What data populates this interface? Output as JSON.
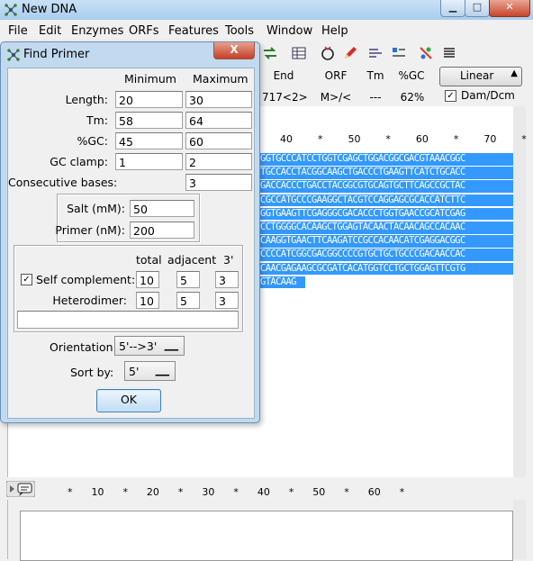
{
  "window": {
    "title": "New DNA",
    "controls": [
      "minimize",
      "maximize",
      "close"
    ]
  },
  "menu": [
    "File",
    "Edit",
    "Enzymes",
    "ORFs",
    "Features",
    "Tools",
    "Window",
    "Help"
  ],
  "info": {
    "headers": {
      "end": "End",
      "orf": "ORF",
      "tm": "Tm",
      "gc": "%GC"
    },
    "values": {
      "end": "717<2>",
      "orf": "M>/<",
      "tm": "---",
      "gc": "62%"
    },
    "topology": "Linear",
    "dam_dcm_label": "Dam/Dcm",
    "dam_dcm_checked": true
  },
  "ruler_top": "40        *        50        *        60        *        70        *",
  "ruler_bottom": "*      10      *      20      *      30      *      40      *      50      *      60      *",
  "sequence_lines": [
    "GGTGCCCATCCTGGTCGAGCTGGACGGCGACGTAAACGGC",
    "TGCCACCTACGGCAAGCTGACCCTGAAGTTCATCTGCACC",
    "GACCACCCTGACCTACGGCGTGCAGTGCTTCAGCCGCTAC",
    "CGCCATGCCCGAAGGCTACGTCCAGGAGCGCACCATCTTC",
    "GGTGAAGTTCGAGGGCGACACCCTGGTGAACCGCATCGAG",
    "CCTGGGGCACAAGCTGGAGTACAACTACAACAGCCACAAC",
    "CAAGGTGAACTTCAAGATCCGCCACAACATCGAGGACGGC",
    "CCCCATCGGCGACGGCCCCGTGCTGCTGCCCGACAACCAC",
    "CAACGAGAAGCGCGATCACATGGTCCTGCTGGAGTTCGTG",
    "GTACAAG"
  ],
  "dialog": {
    "title": "Find Primer",
    "close_label": "X",
    "min_header": "Minimum",
    "max_header": "Maximum",
    "rows": [
      {
        "label": "Length:",
        "min": "20",
        "max": "30"
      },
      {
        "label": "Tm:",
        "min": "58",
        "max": "64"
      },
      {
        "label": "%GC:",
        "min": "45",
        "max": "60"
      },
      {
        "label": "GC clamp:",
        "min": "1",
        "max": "2"
      }
    ],
    "consecutive_label": "Consecutive bases:",
    "consecutive_value": "3",
    "salt_label": "Salt (mM):",
    "salt_value": "50",
    "primer_label": "Primer (nM):",
    "primer_value": "200",
    "dimer_headers": {
      "total": "total",
      "adjacent": "adjacent",
      "three_prime": "3'"
    },
    "self_complement": {
      "label": "Self complement:",
      "checked": true,
      "total": "10",
      "adjacent": "5",
      "three_prime": "3"
    },
    "heterodimer": {
      "label": "Heterodimer:",
      "total": "10",
      "adjacent": "5",
      "three_prime": "3"
    },
    "heterodimer_sequence": "",
    "orientation_label": "Orientation:",
    "orientation_value": "5'-->3'",
    "sortby_label": "Sort by:",
    "sortby_value": "5'",
    "ok_label": "OK"
  }
}
